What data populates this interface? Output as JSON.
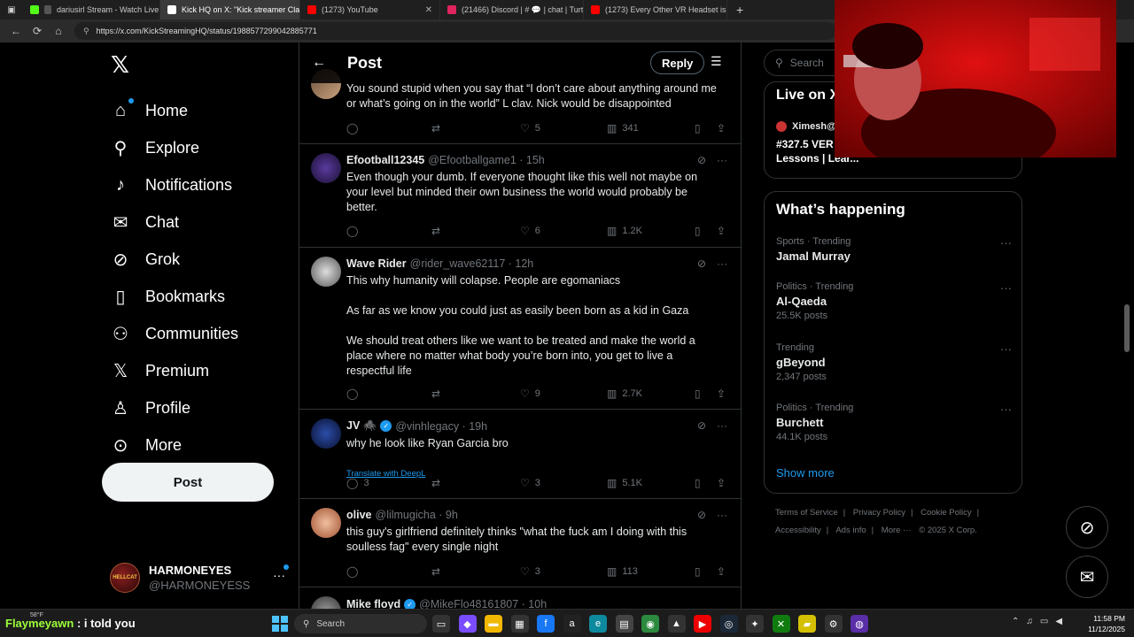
{
  "browser": {
    "tabs": [
      {
        "title": "",
        "color": "#3a3a3a"
      },
      {
        "title": "dariusirl Stream - Watch Live",
        "color": "#53fc18"
      },
      {
        "title": "Kick HQ on X: \"Kick streamer Cla",
        "color": "#ffffff"
      },
      {
        "title": "(1273) YouTube",
        "color": "#ff0000"
      },
      {
        "title": "(21466) Discord | # 💬 | chat | Turt",
        "color": "#e0245e"
      },
      {
        "title": "(1273) Every Other VR Headset is",
        "color": "#ff0000"
      }
    ],
    "url": "https://x.com/KickStreamingHQ/status/1988577299042885771"
  },
  "sidebar": {
    "nav": [
      {
        "label": "Home",
        "icon": "home-icon"
      },
      {
        "label": "Explore",
        "icon": "search-icon"
      },
      {
        "label": "Notifications",
        "icon": "bell-icon"
      },
      {
        "label": "Chat",
        "icon": "mail-icon"
      },
      {
        "label": "Grok",
        "icon": "grok-icon"
      },
      {
        "label": "Bookmarks",
        "icon": "bookmark-icon"
      },
      {
        "label": "Communities",
        "icon": "people-icon"
      },
      {
        "label": "Premium",
        "icon": "x-icon"
      },
      {
        "label": "Profile",
        "icon": "person-icon"
      },
      {
        "label": "More",
        "icon": "more-circle-icon"
      }
    ],
    "post_label": "Post",
    "account": {
      "name": "HARMONEYES",
      "handle": "@HARMONEYESS",
      "avatar_text": "HELLCAT"
    }
  },
  "main": {
    "header": {
      "title": "Post",
      "reply_label": "Reply"
    },
    "tweets": [
      {
        "name": "",
        "handle": "",
        "time": "",
        "verified": false,
        "text": [
          "You sound stupid when you say that “I don’t care about anything around me or what’s going on in the world” L clav. Nick would be disappointed"
        ],
        "replies": "",
        "likes": "5",
        "views": "341"
      },
      {
        "name": "Efootball12345",
        "handle": "@Efootballgame1 · 15h",
        "time": "",
        "verified": false,
        "text": [
          "Even though your dumb. If everyone thought like this well not maybe on your level but minded their own business the world would probably be better."
        ],
        "replies": "",
        "likes": "6",
        "views": "1.2K"
      },
      {
        "name": "Wave Rider",
        "handle": "@rider_wave62117 · 12h",
        "time": "",
        "verified": false,
        "text": [
          "This why humanity will colapse. People are egomaniacs",
          "As far as we know you could just as easily been born as a kid in Gaza",
          "We should treat others like we want to be treated and make the world a place where no matter what body you’re born into, you get to live a respectful life"
        ],
        "replies": "",
        "likes": "9",
        "views": "2.7K"
      },
      {
        "name": "JV 🕷️",
        "handle": "@vinhlegacy · 19h",
        "time": "",
        "verified": true,
        "text": [
          "why he look like Ryan Garcia bro"
        ],
        "translate": "Translate with DeepL",
        "replies": "3",
        "likes": "3",
        "views": "5.1K"
      },
      {
        "name": "olive",
        "handle": "@lilmugicha · 9h",
        "time": "",
        "verified": false,
        "text": [
          "this guy's girlfriend definitely thinks \"what the fuck am I doing with this soulless fag\" every single night"
        ],
        "replies": "",
        "likes": "3",
        "views": "113"
      },
      {
        "name": "Mike floyd",
        "handle": "@MikeFlo48161807 · 10h",
        "time": "",
        "verified": true,
        "text": [
          ""
        ],
        "replies": "",
        "likes": "",
        "views": ""
      }
    ]
  },
  "right": {
    "search_placeholder": "Search",
    "live": {
      "title": "Live on X",
      "host": "Ximesh@",
      "desc": "#327.5 VER COD? | Spanish Lessons | Lear..."
    },
    "happening_title": "What’s happening",
    "trends": [
      {
        "context": "Sports · Trending",
        "name": "Jamal Murray",
        "count": ""
      },
      {
        "context": "Politics · Trending",
        "name": "Al-Qaeda",
        "count": "25.5K posts"
      },
      {
        "context": "Trending",
        "name": "gBeyond",
        "count": "2,347 posts"
      },
      {
        "context": "Politics · Trending",
        "name": "Burchett",
        "count": "44.1K posts"
      }
    ],
    "show_more": "Show more",
    "footer": [
      "Terms of Service",
      "|",
      "Privacy Policy",
      "|",
      "Cookie Policy",
      "|",
      "Accessibility",
      "|",
      "Ads info",
      "|",
      "More ···",
      "© 2025 X Corp."
    ]
  },
  "overlay": {
    "chat_user": "Flaymeyawn",
    "chat_message": " : i told you",
    "weather": "58°F"
  },
  "taskbar": {
    "search_label": "Search",
    "time": "11:58 PM",
    "date": "11/12/2025"
  },
  "colors": {
    "accent": "#1d9bf0",
    "background": "#000000",
    "border": "#2f3336",
    "muted": "#71767b"
  }
}
